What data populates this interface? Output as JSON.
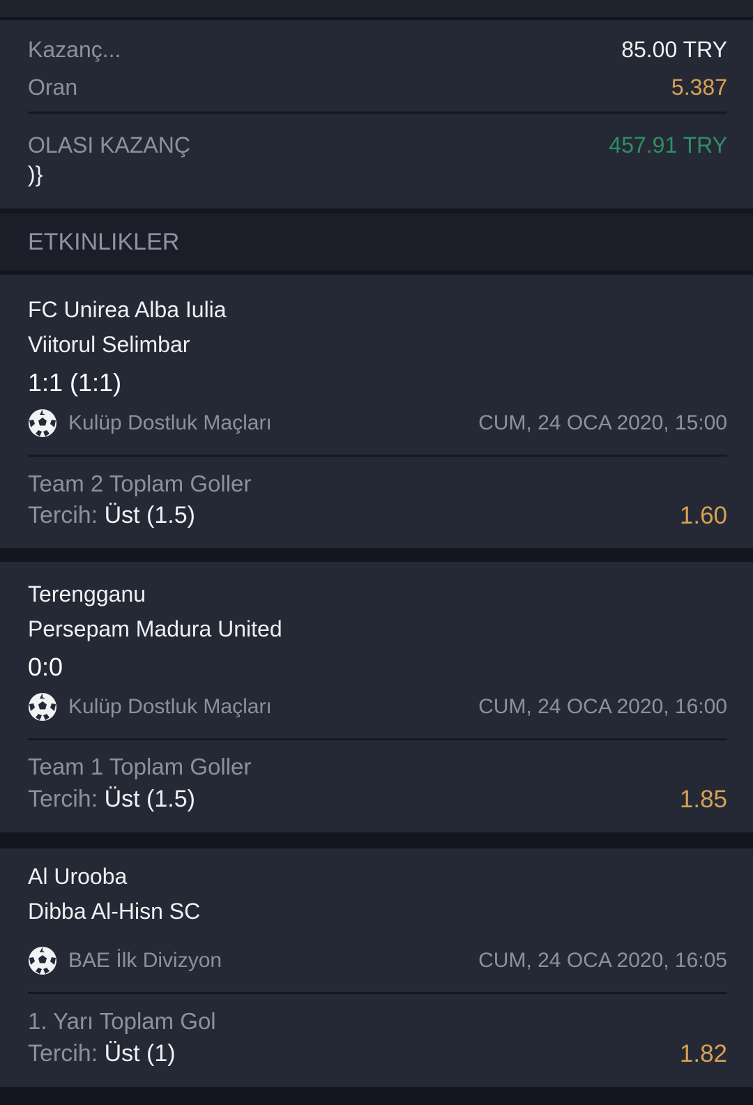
{
  "summary": {
    "stake_label": "Kazanç...",
    "stake_value": "85.00 TRY",
    "odds_label": "Oran",
    "odds_value": "5.387",
    "potential_label": "OLASI KAZANÇ",
    "potential_value": "457.91 TRY",
    "stray_text": ")}"
  },
  "events_header": "ETKINLIKLER",
  "events": [
    {
      "team1": "FC Unirea Alba Iulia",
      "team2": "Viitorul Selimbar",
      "score": "1:1 (1:1)",
      "league": "Kulüp Dostluk Maçları",
      "datetime": "CUM, 24 OCA 2020, 15:00",
      "market": "Team 2 Toplam Goller",
      "pick_label": "Tercih:",
      "pick_value": "Üst (1.5)",
      "odd": "1.60"
    },
    {
      "team1": "Terengganu",
      "team2": "Persepam Madura United",
      "score": "0:0",
      "league": "Kulüp Dostluk Maçları",
      "datetime": "CUM, 24 OCA 2020, 16:00",
      "market": "Team 1 Toplam Goller",
      "pick_label": "Tercih:",
      "pick_value": "Üst (1.5)",
      "odd": "1.85"
    },
    {
      "team1": "Al Urooba",
      "team2": "Dibba Al-Hisn SC",
      "score": "",
      "league": "BAE İlk Divizyon",
      "datetime": "CUM, 24 OCA 2020, 16:05",
      "market": "1. Yarı Toplam Gol",
      "pick_label": "Tercih:",
      "pick_value": "Üst (1)",
      "odd": "1.82"
    }
  ],
  "icons": {
    "sport": "soccer-ball-icon"
  },
  "colors": {
    "odds": "#d6a253",
    "potential_win": "#2f8f62",
    "background": "#252935"
  }
}
